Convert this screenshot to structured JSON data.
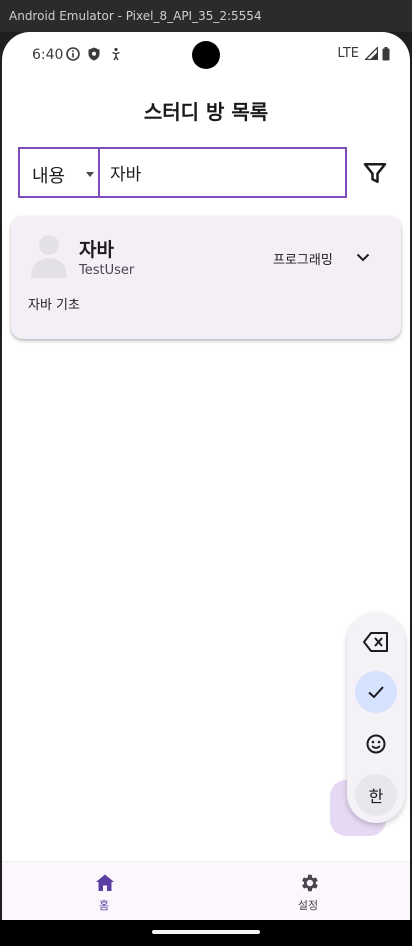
{
  "window": {
    "title": "Android Emulator - Pixel_8_API_35_2:5554"
  },
  "status_bar": {
    "time": "6:40",
    "network": "LTE"
  },
  "header": {
    "title": "스터디 방 목록"
  },
  "search": {
    "filter_selected": "내용",
    "query": "자바"
  },
  "rooms": [
    {
      "title": "자바",
      "owner": "TestUser",
      "category": "프로그래밍",
      "description": "자바 기초"
    }
  ],
  "keyboard_toolbar": {
    "language_key": "한"
  },
  "bottom_nav": {
    "items": [
      {
        "label": "홈",
        "icon": "home-icon",
        "active": true
      },
      {
        "label": "설정",
        "icon": "gear-icon",
        "active": false
      }
    ]
  },
  "colors": {
    "accent": "#7c4dbb",
    "card_background": "#f4eff7",
    "nav_active": "#5b3ea2",
    "fab": "#e6d9f3"
  }
}
